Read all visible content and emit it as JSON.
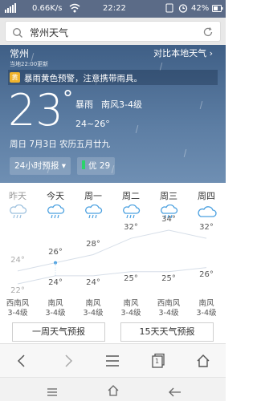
{
  "status_bar": {
    "carrier": "",
    "network_speed": "0.66K/s",
    "time": "22:22",
    "battery": "42%"
  },
  "search": {
    "query": "常州天气"
  },
  "hero": {
    "city": "常州",
    "compare_link": "对比本地天气",
    "updated": "当地22:00更新",
    "alert_badge": "黄",
    "alert_text": "暴雨黄色预警，注意携带雨具。",
    "temperature": "23",
    "degree": "°",
    "condition": "暴雨",
    "wind": "南风3-4级",
    "range": "24~26°",
    "date": "周日 7月3日   农历五月廿九",
    "forecast_button": "24小时预报",
    "aqi_label": "优 29",
    "colors": {
      "aqi": "#2bd36b",
      "alert": "#f0b32c"
    }
  },
  "days": [
    {
      "name": "昨天",
      "icon": "rain-icon",
      "hi": "24°",
      "lo": "22°",
      "wind": "西南风",
      "level": "3-4级",
      "past": true
    },
    {
      "name": "今天",
      "icon": "rain-icon",
      "hi": "26°",
      "lo": "24°",
      "wind": "南风",
      "level": "3-4级",
      "past": false
    },
    {
      "name": "周一",
      "icon": "rain-icon",
      "hi": "28°",
      "lo": "24°",
      "wind": "南风",
      "level": "3-4级",
      "past": false
    },
    {
      "name": "周二",
      "icon": "rain-icon",
      "hi": "32°",
      "lo": "25°",
      "wind": "南风",
      "level": "3-4级",
      "past": false
    },
    {
      "name": "周三",
      "icon": "rain-icon",
      "hi": "34°",
      "lo": "25°",
      "wind": "西南风",
      "level": "3-4级",
      "past": false
    },
    {
      "name": "周四",
      "icon": "cloud-icon",
      "hi": "32°",
      "lo": "26°",
      "wind": "南风",
      "level": "3-4级",
      "past": false
    }
  ],
  "buttons": {
    "week": "一周天气预报",
    "fifteen": "15天天气预报"
  },
  "browser_bar": {
    "back": "back-icon",
    "forward": "forward-icon",
    "menu": "menu-icon",
    "tabs_count": "1",
    "home": "home-icon"
  }
}
